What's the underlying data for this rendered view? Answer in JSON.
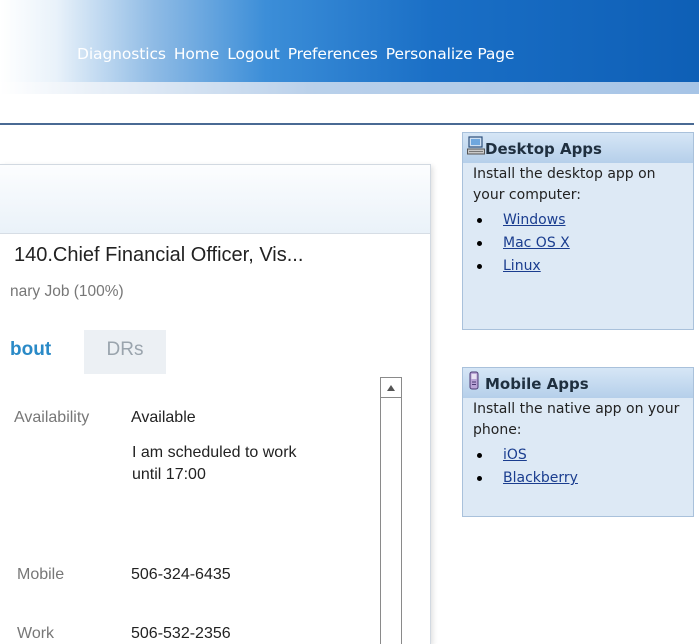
{
  "topnav": {
    "items": [
      "Diagnostics",
      "Home",
      "Logout",
      "Preferences",
      "Personalize Page"
    ]
  },
  "profile": {
    "position_title": "140.Chief Financial Officer, Vis...",
    "job_subtitle": "nary Job (100%)",
    "tabs": {
      "about": "bout",
      "drs": "DRs"
    },
    "fields": {
      "availability_label": "Availability",
      "availability_value": "Available",
      "schedule_note": "I am scheduled to work until 17:00",
      "mobile_label": "Mobile",
      "mobile_value": "506-324-6435",
      "work_label": "Work",
      "work_value": "506-532-2356"
    }
  },
  "desktop_apps": {
    "title": "Desktop Apps",
    "description": "Install the desktop app on your computer:",
    "links": [
      "Windows",
      "Mac OS X",
      "Linux"
    ],
    "icon": "computer-icon"
  },
  "mobile_apps": {
    "title": "Mobile Apps",
    "description": "Install the native app on your phone:",
    "links": [
      "iOS",
      "Blackberry"
    ],
    "icon": "mobile-phone-icon"
  },
  "colors": {
    "accent_blue": "#2a8ac7",
    "link_blue": "#1a3d8f",
    "box_background": "#dde9f5"
  }
}
